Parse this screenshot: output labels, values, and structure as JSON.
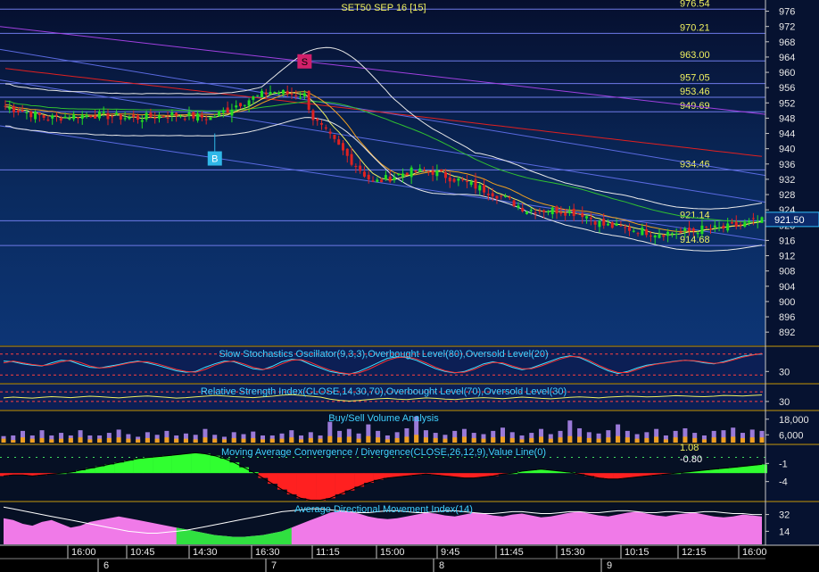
{
  "chart_data": [
    {
      "type": "candlestick",
      "title": "SET50 SEP 16  [15]",
      "ylim": [
        889,
        978
      ],
      "yticks": [
        892,
        896,
        900,
        904,
        908,
        912,
        916,
        920,
        924,
        928,
        932,
        936,
        940,
        944,
        948,
        952,
        956,
        960,
        964,
        968,
        972,
        976
      ],
      "price_levels": [
        {
          "label": "976.54",
          "value": 976.54
        },
        {
          "label": "970.21",
          "value": 970.21
        },
        {
          "label": "963.00",
          "value": 963.0
        },
        {
          "label": "957.05",
          "value": 957.05
        },
        {
          "label": "953.46",
          "value": 953.46
        },
        {
          "label": "949.69",
          "value": 949.69
        },
        {
          "label": "934.46",
          "value": 934.46
        },
        {
          "label": "921.14",
          "value": 921.14
        },
        {
          "label": "914.68",
          "value": 914.68
        }
      ],
      "last_price": "921.50",
      "signals": [
        {
          "label": "B",
          "bar": 49,
          "value": 944,
          "color": "#30b8e8"
        },
        {
          "label": "S",
          "bar": 70,
          "value": 961,
          "color": "#d0206a"
        }
      ],
      "close_path": [
        [
          0,
          951
        ],
        [
          10,
          948
        ],
        [
          20,
          949
        ],
        [
          30,
          948
        ],
        [
          40,
          949
        ],
        [
          48,
          948
        ],
        [
          55,
          952
        ],
        [
          62,
          955
        ],
        [
          70,
          954
        ],
        [
          72,
          948
        ],
        [
          80,
          938
        ],
        [
          86,
          931
        ],
        [
          94,
          934
        ],
        [
          100,
          934
        ],
        [
          108,
          931
        ],
        [
          115,
          928
        ],
        [
          122,
          924
        ],
        [
          128,
          924
        ],
        [
          135,
          923
        ],
        [
          140,
          920
        ],
        [
          146,
          919
        ],
        [
          152,
          918
        ],
        [
          158,
          918
        ],
        [
          163,
          919
        ],
        [
          167,
          919
        ],
        [
          172,
          920
        ],
        [
          176,
          921
        ]
      ],
      "colors": {
        "up": "#22dd22",
        "down": "#dd2222"
      }
    },
    {
      "type": "line",
      "title": "Slow Stochastics Oscillator(9,3,3),Overbought Level(80),Oversold Level(20)",
      "ylim": [
        0,
        100
      ],
      "yticks": [
        30
      ],
      "series": [
        {
          "values": [
            60,
            58,
            52,
            48,
            46,
            55,
            62,
            60,
            50,
            42,
            40,
            45,
            50,
            56,
            60,
            55,
            48,
            40,
            32,
            28,
            30,
            42,
            52,
            60,
            58,
            48,
            38,
            35,
            45,
            58,
            65,
            62,
            50,
            40,
            30,
            25,
            22,
            30,
            42,
            55,
            68,
            72,
            70,
            62,
            50,
            38,
            30,
            26,
            30,
            40,
            52,
            58,
            52,
            42,
            35,
            40,
            50,
            60,
            70,
            75,
            70,
            58,
            44,
            32,
            24,
            30,
            40,
            48,
            52,
            56,
            60,
            62,
            60,
            55,
            52,
            58,
            66,
            74,
            78,
            80
          ]
        },
        {
          "values": [
            55,
            60,
            55,
            50,
            47,
            50,
            58,
            62,
            56,
            46,
            40,
            42,
            48,
            54,
            58,
            58,
            52,
            44,
            36,
            30,
            28,
            36,
            48,
            57,
            60,
            52,
            42,
            36,
            40,
            52,
            62,
            64,
            56,
            44,
            34,
            27,
            23,
            26,
            36,
            49,
            62,
            70,
            72,
            66,
            55,
            42,
            32,
            27,
            28,
            36,
            48,
            56,
            55,
            46,
            38,
            38,
            46,
            56,
            66,
            73,
            72,
            62,
            48,
            36,
            27,
            27,
            36,
            45,
            51,
            55,
            59,
            62,
            61,
            57,
            53,
            56,
            63,
            71,
            77,
            82
          ]
        }
      ]
    },
    {
      "type": "line",
      "title": "Relative Strength Index(CLOSE,14,30,70),Overbought Level(70),Oversold Level(30)",
      "ylim": [
        0,
        100
      ],
      "yticks": [
        30
      ],
      "series": [
        {
          "values": [
            45,
            48,
            46,
            44,
            47,
            50,
            48,
            46,
            49,
            52,
            50,
            47,
            45,
            48,
            51,
            53,
            50,
            47,
            44,
            46,
            49,
            52,
            55,
            53,
            50,
            48,
            46,
            49,
            52,
            56,
            58,
            55,
            52,
            48,
            40,
            35,
            32,
            34,
            38,
            41,
            43,
            40,
            38,
            42,
            45,
            43,
            40,
            38,
            41,
            44,
            46,
            44,
            42,
            45,
            48,
            46,
            43,
            41,
            44,
            47,
            49,
            47,
            45,
            48,
            50,
            52,
            51,
            49,
            50,
            52,
            54,
            53,
            51,
            50,
            52,
            55,
            54,
            53,
            55,
            57
          ]
        }
      ]
    },
    {
      "type": "bar",
      "title": "Buy/Sell Volume Analysis",
      "ylim": [
        0,
        24000
      ],
      "yticks": [
        6000,
        18000
      ],
      "series": [
        {
          "name": "up",
          "values": [
            2000,
            3500,
            5000,
            2500,
            6000,
            3000,
            4500,
            2000,
            5500,
            3000,
            2500,
            4000,
            6000,
            3500,
            2000,
            4500,
            3000,
            5000,
            2500,
            4000,
            3500,
            6500,
            3000,
            2000,
            4500,
            3500,
            5000,
            3000,
            2500,
            4000,
            5500,
            3000,
            4500,
            2500,
            11000,
            5000,
            6000,
            4000,
            9000,
            5000,
            3000,
            4500,
            6500,
            14000,
            5500,
            4000,
            3000,
            5000,
            6000,
            4000,
            3500,
            5000,
            7000,
            4500,
            3000,
            4000,
            6000,
            3500,
            5000,
            12000,
            6500,
            4500,
            4000,
            5500,
            9000,
            5000,
            3500,
            4500,
            6000,
            3000,
            5000,
            6500,
            4000,
            3000,
            5000,
            5500,
            7000,
            4000,
            6000,
            5000
          ]
        },
        {
          "name": "down",
          "values": [
            3000,
            2000,
            4000,
            3000,
            3500,
            2500,
            3000,
            3500,
            4000,
            2500,
            3000,
            3500,
            4000,
            3000,
            2500,
            3500,
            3000,
            4000,
            3000,
            3000,
            2500,
            4000,
            3000,
            2500,
            3500,
            3000,
            3500,
            2500,
            3000,
            3000,
            4000,
            2500,
            3500,
            3000,
            5000,
            4000,
            4500,
            3000,
            5000,
            4000,
            2500,
            3500,
            4500,
            6000,
            4000,
            3500,
            3000,
            4000,
            4500,
            3500,
            3000,
            4000,
            4500,
            3500,
            2500,
            3500,
            4500,
            3000,
            4000,
            5000,
            4500,
            3500,
            3000,
            4000,
            5000,
            4000,
            3000,
            3500,
            4500,
            2500,
            4000,
            4500,
            3500,
            2500,
            4000,
            4000,
            4500,
            3500,
            4000,
            4000
          ]
        }
      ]
    },
    {
      "type": "bar",
      "title": "Moving Average Convergence / Divergence(CLOSE,26,12,9),Value Line(0)",
      "ylim": [
        -7,
        2
      ],
      "yticks": [
        -1,
        -4
      ],
      "value_labels": [
        "1.08",
        "-0.80"
      ],
      "series": [
        {
          "values": [
            -0.3,
            -0.2,
            -0.2,
            -0.3,
            -0.2,
            -0.1,
            0.0,
            0.1,
            0.3,
            0.5,
            0.7,
            0.9,
            1.1,
            1.3,
            1.5,
            1.6,
            1.7,
            1.8,
            1.9,
            2.0,
            2.1,
            2.0,
            1.8,
            1.5,
            1.1,
            0.6,
            0.1,
            -0.5,
            -1.1,
            -1.7,
            -2.2,
            -2.6,
            -2.8,
            -2.8,
            -2.6,
            -2.2,
            -1.8,
            -1.4,
            -1.0,
            -0.7,
            -0.5,
            -0.4,
            -0.3,
            -0.2,
            -0.1,
            -0.2,
            -0.3,
            -0.4,
            -0.5,
            -0.5,
            -0.4,
            -0.3,
            -0.1,
            0.0,
            0.2,
            0.3,
            0.4,
            0.3,
            0.2,
            0.1,
            -0.1,
            -0.3,
            -0.5,
            -0.6,
            -0.6,
            -0.5,
            -0.4,
            -0.3,
            -0.2,
            -0.1,
            0.0,
            0.1,
            0.2,
            0.3,
            0.4,
            0.5,
            0.6,
            0.7,
            0.8,
            0.9
          ]
        }
      ]
    },
    {
      "type": "area",
      "title": "Average Directional Movement Index(14)",
      "ylim": [
        0,
        45
      ],
      "yticks": [
        14,
        32
      ],
      "series": [
        {
          "values": [
            28,
            26,
            22,
            20,
            24,
            26,
            22,
            18,
            20,
            24,
            26,
            28,
            30,
            28,
            26,
            24,
            22,
            20,
            18,
            16,
            14,
            12,
            10,
            9,
            8,
            8,
            9,
            10,
            12,
            14,
            18,
            22,
            26,
            30,
            34,
            36,
            35,
            33,
            30,
            28,
            27,
            28,
            30,
            32,
            34,
            33,
            31,
            30,
            32,
            34,
            33,
            31,
            30,
            32,
            33,
            31,
            29,
            30,
            32,
            34,
            35,
            33,
            31,
            30,
            32,
            34,
            35,
            33,
            31,
            30,
            32,
            33,
            34,
            32,
            30,
            29,
            30,
            32,
            31,
            30
          ]
        },
        {
          "values": [
            40,
            38,
            36,
            34,
            32,
            30,
            28,
            26,
            24,
            22,
            20,
            18,
            16,
            14,
            13,
            12,
            12,
            13,
            14,
            15,
            17,
            19,
            21,
            23,
            25,
            27,
            29,
            31,
            33,
            35,
            36,
            37,
            38,
            38,
            37,
            36,
            35,
            34,
            34,
            35,
            36,
            36,
            35,
            34,
            34,
            35,
            36,
            36,
            35,
            34,
            33,
            33,
            34,
            35,
            35,
            34,
            33,
            33,
            34,
            35,
            35,
            34,
            34,
            35,
            36,
            36,
            35,
            34,
            34,
            35,
            35,
            34,
            34,
            35,
            35,
            34,
            33,
            33,
            32,
            32
          ]
        }
      ]
    }
  ],
  "x_axis": {
    "time_labels": [
      "16:00",
      "10:45",
      "14:30",
      "16:30",
      "11:15",
      "15:00",
      "9:45",
      "11:45",
      "15:30",
      "10:15",
      "12:15",
      "16:00"
    ],
    "day_labels": [
      "6",
      "7",
      "8",
      "9"
    ]
  }
}
